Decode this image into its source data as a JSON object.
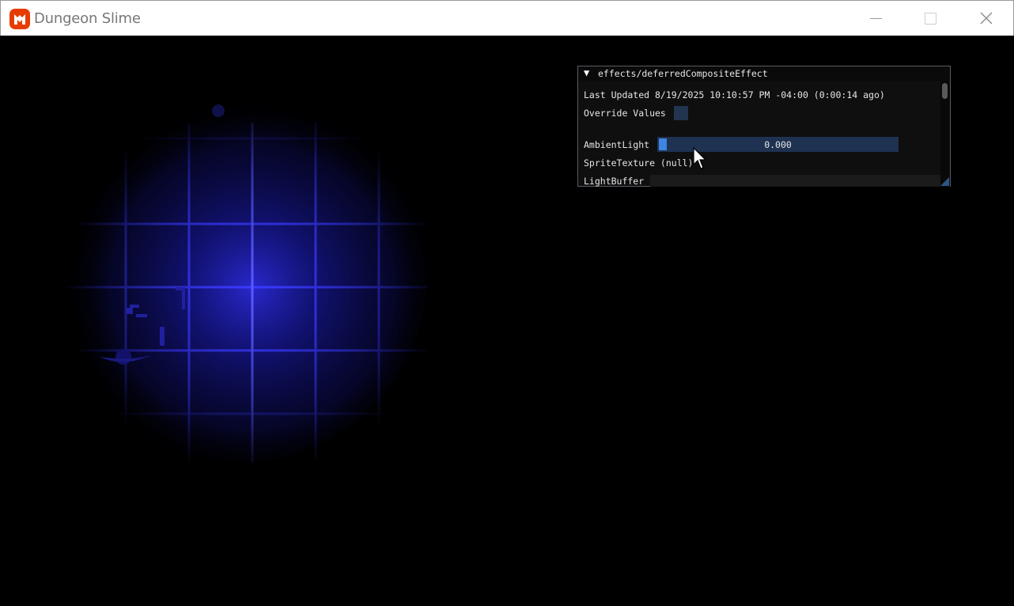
{
  "window": {
    "title": "Dungeon Slime",
    "icon": "monogame-logo-icon",
    "controls": [
      "minimize-icon",
      "maximize-icon",
      "close-icon"
    ],
    "accent_color": "#e73c00"
  },
  "game": {
    "background_color": "#000000",
    "light_color": "#3a3ae0",
    "tile_color": "#1c1cb0"
  },
  "panel": {
    "title": "effects/deferredCompositeEffect",
    "collapse_glyph": "▼",
    "last_updated": "Last Updated  8/19/2025 10:10:57 PM -04:00 (0:00:14 ago)",
    "override_label": "Override Values",
    "override_checked": false,
    "ambient_label": "AmbientLight",
    "ambient_value": "0.000",
    "ambient_fraction": 0.0,
    "sprite_texture": "SpriteTexture (null)",
    "light_buffer_label": "LightBuffer",
    "slider_color": "#3d85e0",
    "frame_color": "#1f3252"
  }
}
